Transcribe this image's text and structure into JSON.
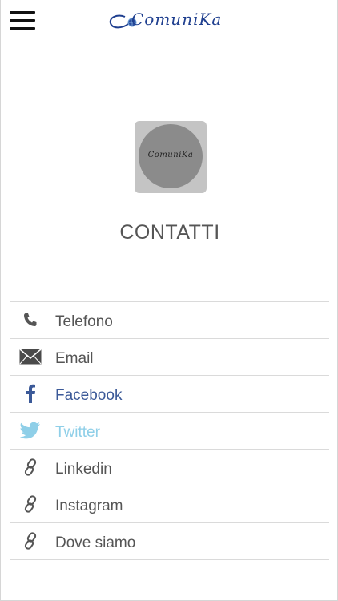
{
  "header": {
    "logo_text": "ComuniKa"
  },
  "hero": {
    "logo_text": "ComuniKa",
    "title": "CONTATTI"
  },
  "contacts": {
    "items": [
      {
        "label": "Telefono",
        "icon": "phone-icon"
      },
      {
        "label": "Email",
        "icon": "envelope-icon"
      },
      {
        "label": "Facebook",
        "icon": "facebook-icon"
      },
      {
        "label": "Twitter",
        "icon": "twitter-icon"
      },
      {
        "label": "Linkedin",
        "icon": "link-icon"
      },
      {
        "label": "Instagram",
        "icon": "link-icon"
      },
      {
        "label": "Dove siamo",
        "icon": "link-icon"
      }
    ]
  },
  "colors": {
    "logo_blue": "#1f3f8f",
    "facebook": "#3b5998",
    "twitter": "#8fcfe8",
    "text": "#555555"
  }
}
